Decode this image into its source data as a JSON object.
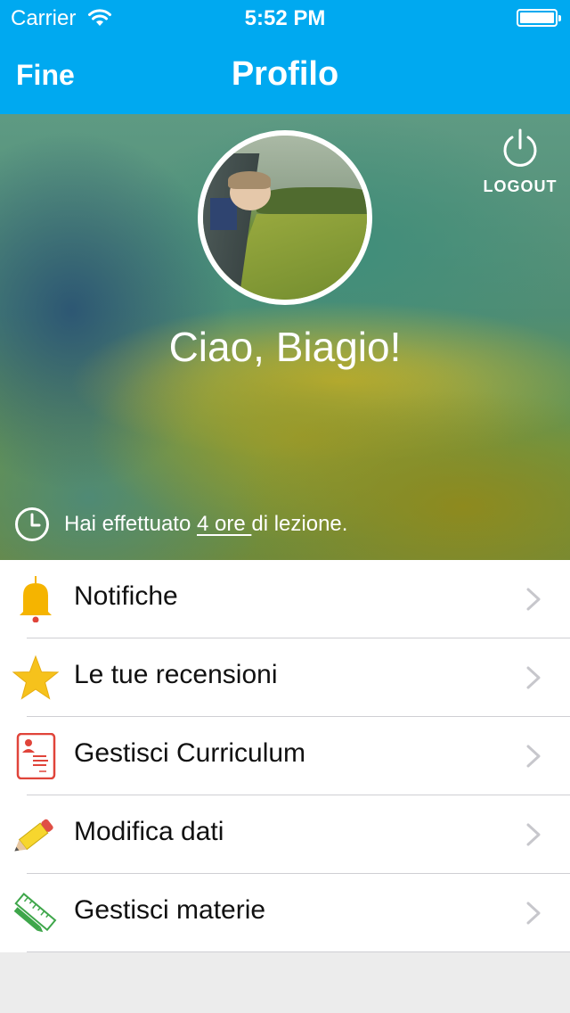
{
  "status_bar": {
    "carrier": "Carrier",
    "time": "5:52 PM"
  },
  "nav": {
    "left_button": "Fine",
    "title": "Profilo"
  },
  "profile": {
    "greeting": "Ciao, Biagio!",
    "logout_label": "LOGOUT",
    "lessons_prefix": "Hai effettuato ",
    "lessons_hours": "4 ore ",
    "lessons_suffix": "di lezione."
  },
  "menu": {
    "items": [
      {
        "label": "Notifiche",
        "icon": "bell-icon"
      },
      {
        "label": "Le tue recensioni",
        "icon": "star-icon"
      },
      {
        "label": "Gestisci Curriculum",
        "icon": "resume-icon"
      },
      {
        "label": "Modifica dati",
        "icon": "pencil-icon"
      },
      {
        "label": "Gestisci materie",
        "icon": "ruler-pencil-icon"
      }
    ]
  },
  "colors": {
    "nav_bar": "#00a9f0",
    "bell": "#f5b400",
    "star": "#f6c21c",
    "resume": "#e0443a",
    "ruler": "#3ea64a",
    "chevron": "#c7c7cc"
  }
}
